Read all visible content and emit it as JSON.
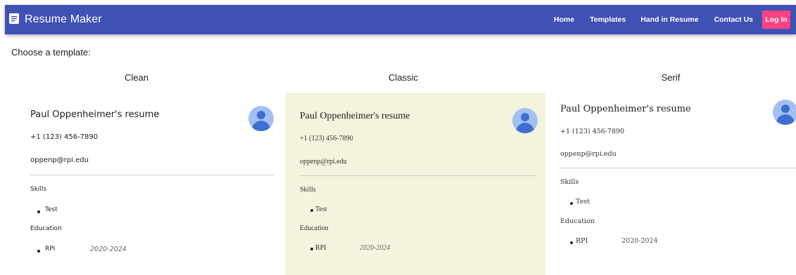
{
  "app": {
    "title": "Resume Maker",
    "brand_icon": "document-icon",
    "colors": {
      "navbar": "#3f51b5",
      "login": "#ff4081",
      "classic_bg": "#f3f3de",
      "avatar": "#a3c0f2"
    }
  },
  "nav": {
    "links": [
      "Home",
      "Templates",
      "Hand in Resume",
      "Contact Us"
    ],
    "login": "Log In"
  },
  "main": {
    "heading": "Choose a template:",
    "templates": [
      {
        "name": "Clean"
      },
      {
        "name": "Classic"
      },
      {
        "name": "Serif"
      }
    ]
  },
  "resume": {
    "name_line": "Paul Oppenheimer's resume",
    "phone": "+1 (123) 456-7890",
    "email": "oppenp@rpi.edu",
    "skills_label": "Skills",
    "skills": [
      "Test"
    ],
    "education_label": "Education",
    "education": [
      {
        "school": "RPI",
        "years": "2020-2024"
      }
    ],
    "avatar_icon": "user-avatar-icon"
  }
}
